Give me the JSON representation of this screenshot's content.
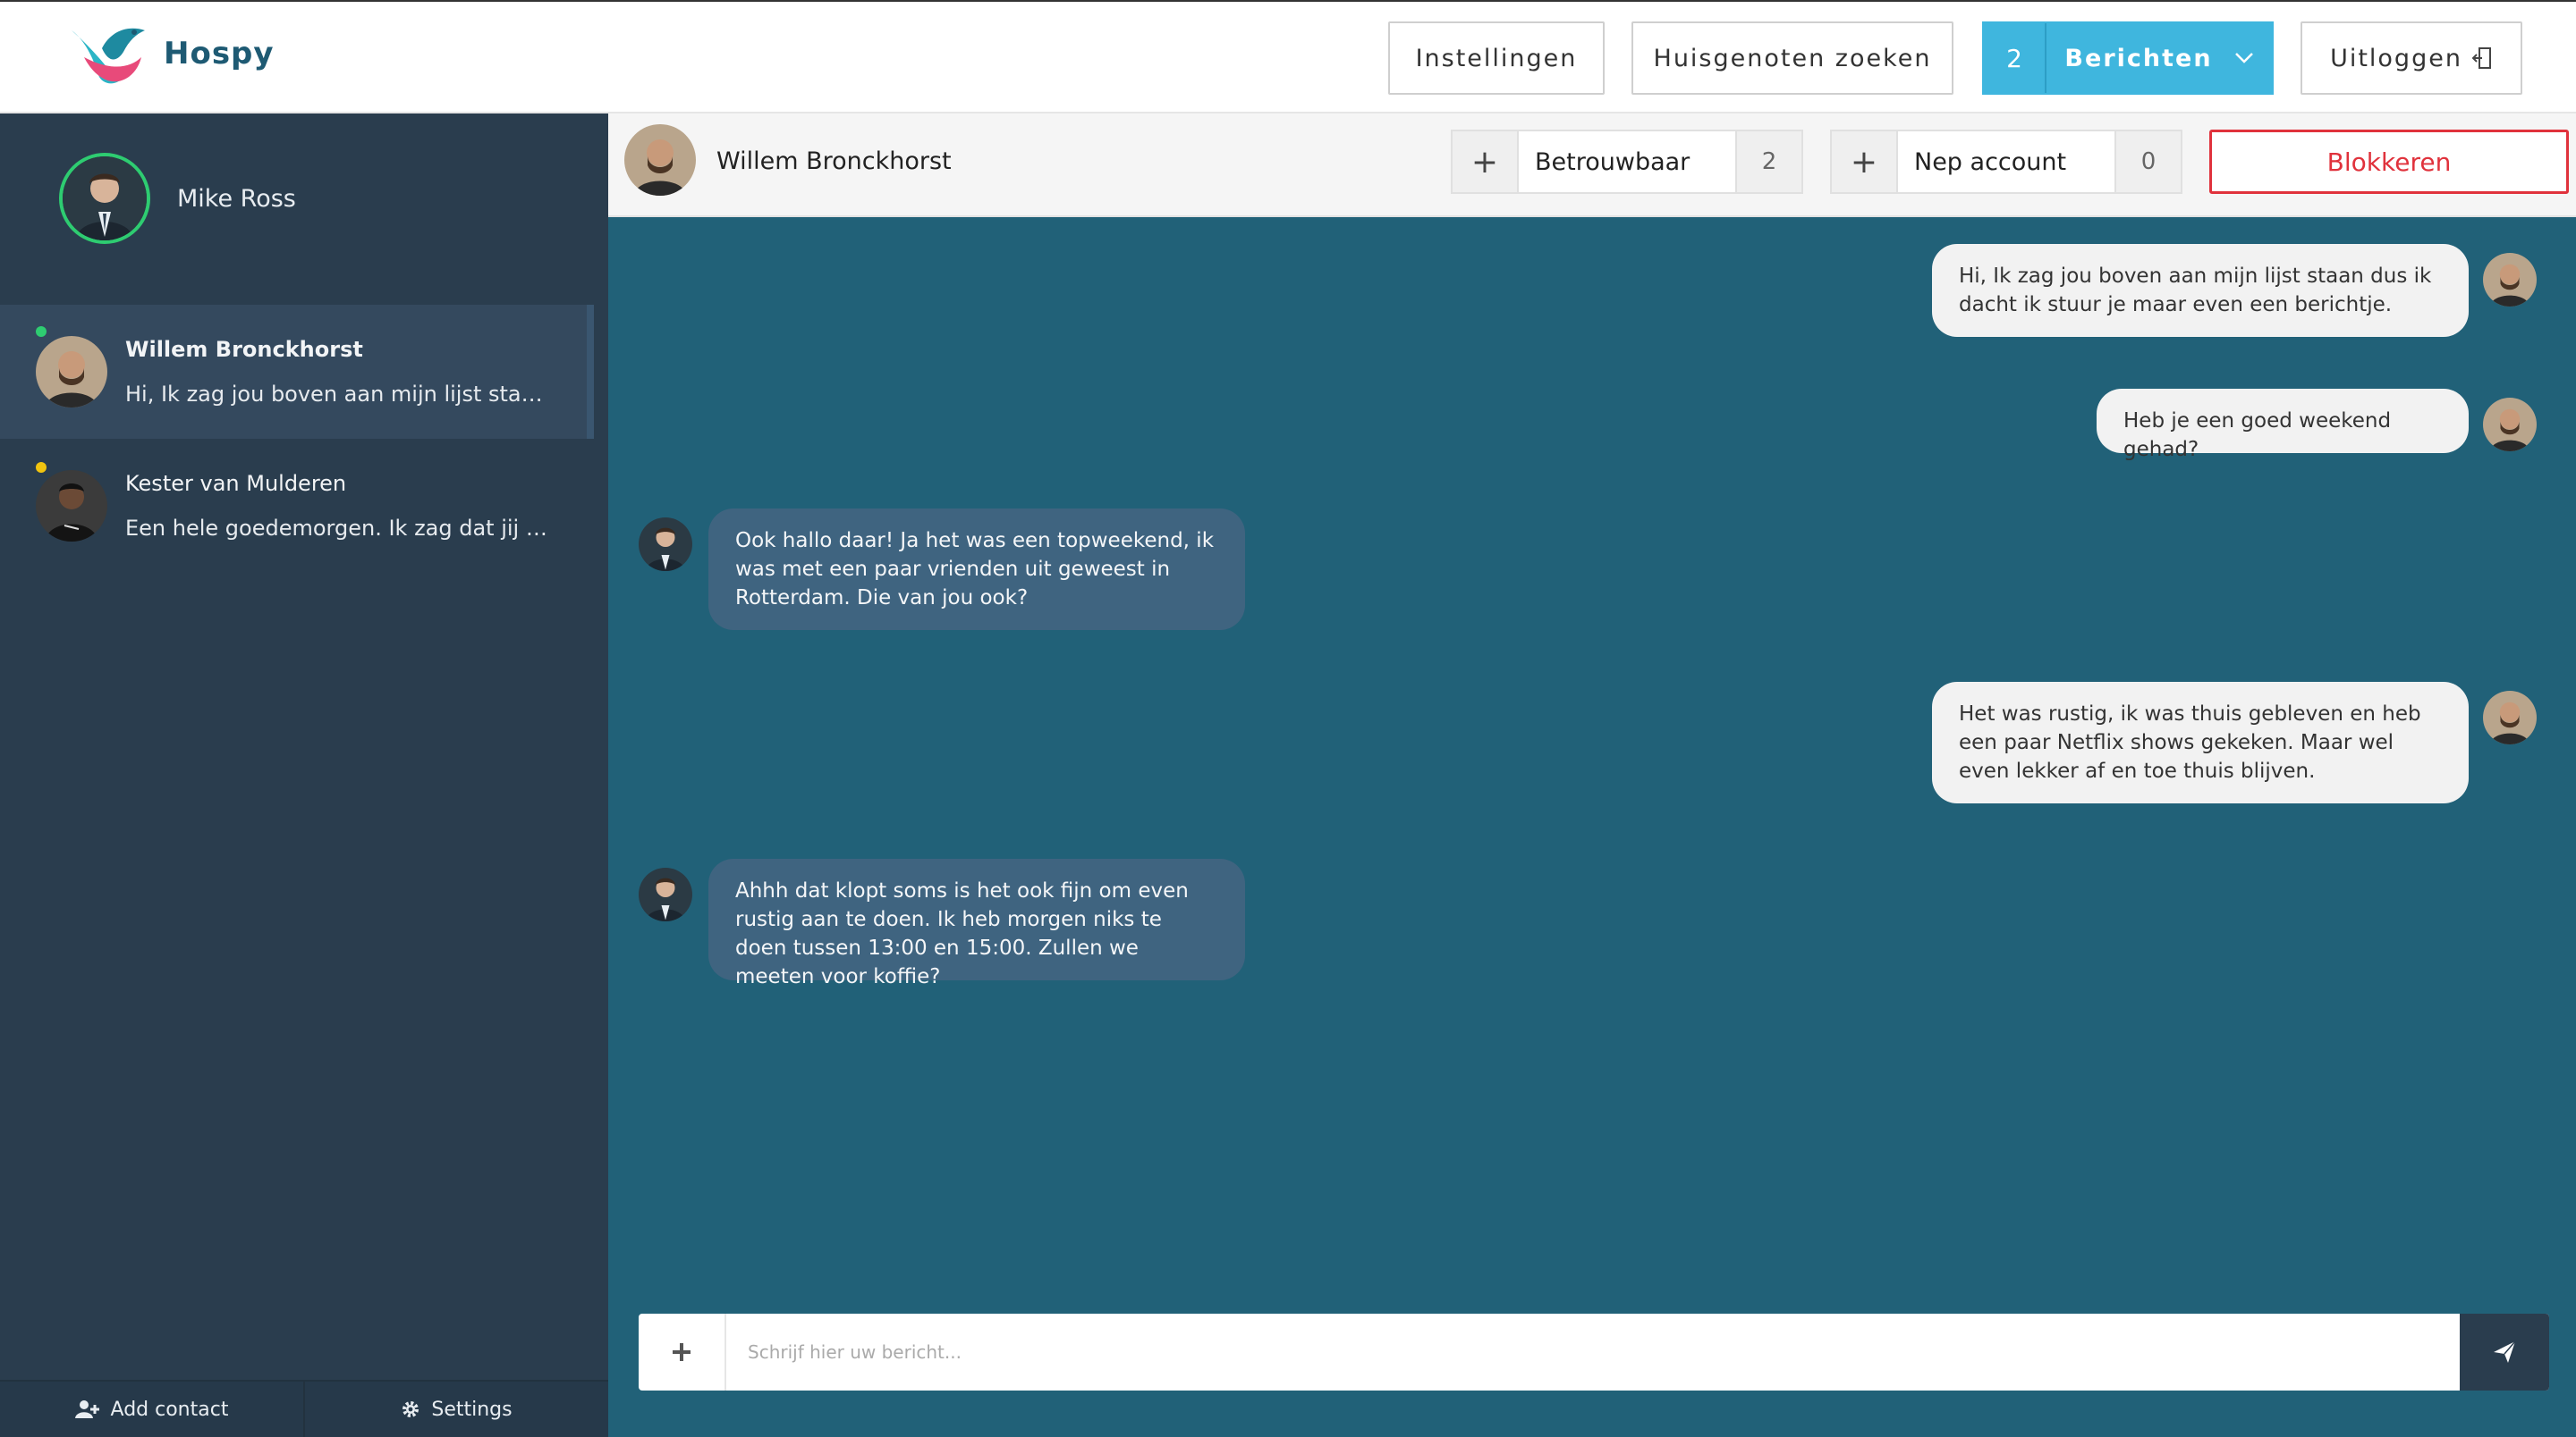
{
  "app": {
    "brand": "Hospy"
  },
  "topnav": {
    "settings_label": "Instellingen",
    "search_label": "Huisgenoten zoeken",
    "messages_count": "2",
    "messages_label": "Berichten",
    "logout_label": "Uitloggen"
  },
  "sidebar": {
    "me": {
      "name": "Mike Ross"
    },
    "contacts": [
      {
        "name": "Willem Bronckhorst",
        "preview": "Hi, Ik zag jou boven aan mijn lijst staan dus ik dacht ik stuur je maar even een berichtje.",
        "status_color": "#2ecc71",
        "active": true
      },
      {
        "name": "Kester van Mulderen",
        "preview": "Een hele goedemorgen. Ik zag dat jij ook op zoek bent naar een kamer.",
        "status_color": "#f1c40f",
        "active": false
      }
    ],
    "footer": {
      "add_contact": "Add contact",
      "settings": "Settings"
    }
  },
  "chat_header": {
    "name": "Willem Bronckhorst",
    "trust_label": "Betrouwbaar",
    "trust_count": "2",
    "fake_label": "Nep account",
    "fake_count": "0",
    "block_label": "Blokkeren"
  },
  "messages": [
    {
      "dir": "out",
      "text": "Hi, Ik zag jou boven aan mijn lijst staan dus ik dacht ik stuur je maar even een berichtje."
    },
    {
      "dir": "out",
      "text": "Heb je een goed weekend gehad?"
    },
    {
      "dir": "in",
      "text": "Ook hallo daar! Ja het was een topweekend, ik was met een paar vrienden uit geweest in Rotterdam. Die van jou ook?"
    },
    {
      "dir": "out",
      "text": "Het was rustig, ik was thuis gebleven en heb een paar Netflix shows gekeken. Maar wel even lekker af en toe thuis blijven."
    },
    {
      "dir": "in",
      "text": "Ahhh dat klopt soms is het ook fijn om even rustig aan te doen. Ik heb morgen niks te doen tussen 13:00 en 15:00. Zullen we meeten voor koffie?"
    }
  ],
  "composer": {
    "placeholder": "Schrijf hier uw bericht..."
  },
  "colors": {
    "accent": "#3fb6de",
    "chat_bg": "#216178",
    "sidebar_bg": "#2a3d4e",
    "danger": "#e0323c",
    "online": "#2ecc71",
    "away": "#f1c40f"
  }
}
